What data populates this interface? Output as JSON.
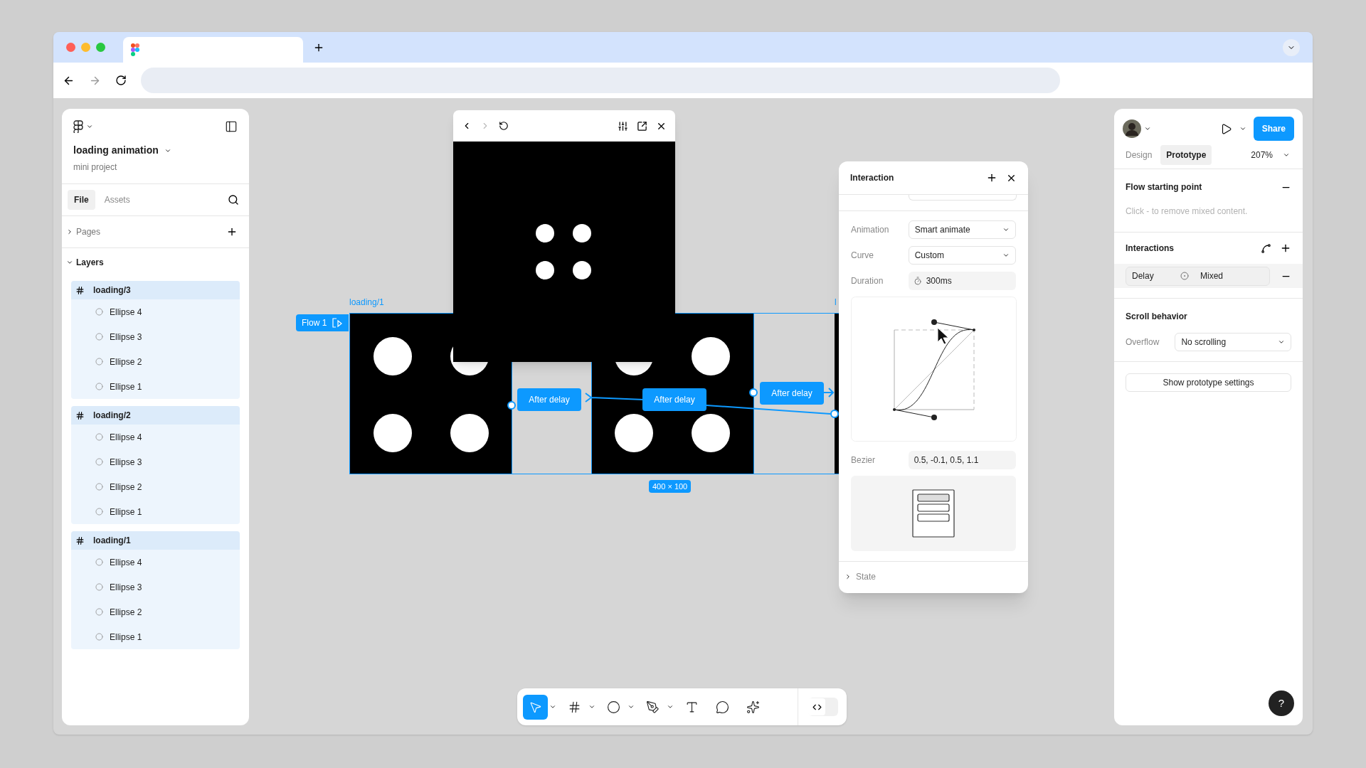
{
  "file": {
    "name": "loading animation",
    "project": "mini project"
  },
  "left_tabs": [
    {
      "label": "File",
      "selected": true
    },
    {
      "label": "Assets",
      "selected": false
    }
  ],
  "pages": {
    "label": "Pages",
    "expanded": false
  },
  "layers": {
    "label": "Layers",
    "expanded": true,
    "items": [
      {
        "name": "loading/3",
        "selected": true,
        "children": [
          {
            "name": "Ellipse 4"
          },
          {
            "name": "Ellipse 3"
          },
          {
            "name": "Ellipse 2"
          },
          {
            "name": "Ellipse 1"
          }
        ]
      },
      {
        "name": "loading/2",
        "selected": true,
        "children": [
          {
            "name": "Ellipse 4"
          },
          {
            "name": "Ellipse 3"
          },
          {
            "name": "Ellipse 2"
          },
          {
            "name": "Ellipse 1"
          }
        ]
      },
      {
        "name": "loading/1",
        "selected": true,
        "children": [
          {
            "name": "Ellipse 4"
          },
          {
            "name": "Ellipse 3"
          },
          {
            "name": "Ellipse 2"
          },
          {
            "name": "Ellipse 1"
          }
        ]
      }
    ]
  },
  "canvas": {
    "frame_labels": [
      "loading/1",
      "l"
    ],
    "flow_badge": "Flow 1",
    "connections": [
      "After delay",
      "After delay",
      "After delay"
    ],
    "size_badge": "400 × 100"
  },
  "interaction_panel": {
    "title": "Interaction",
    "rows": [
      {
        "kind": "dropdown",
        "label": "Animation",
        "value": "Smart animate"
      },
      {
        "kind": "dropdown",
        "label": "Curve",
        "value": "Custom"
      },
      {
        "kind": "duration",
        "label": "Duration",
        "value": "300ms"
      }
    ],
    "bezier": {
      "label": "Bezier",
      "value": "0.5, -0.1, 0.5, 1.1"
    },
    "state": {
      "label": "State",
      "expanded": false
    }
  },
  "right_panel": {
    "share": "Share",
    "tabs": [
      {
        "label": "Design",
        "selected": false
      },
      {
        "label": "Prototype",
        "selected": true
      }
    ],
    "zoom": "207%",
    "flow_start": {
      "title": "Flow starting point",
      "hint": "Click - to remove mixed content."
    },
    "interactions": {
      "title": "Interactions",
      "items": [
        {
          "trigger": "Delay",
          "action": "Mixed"
        }
      ]
    },
    "scroll": {
      "title": "Scroll behavior",
      "label": "Overflow",
      "value": "No scrolling"
    },
    "settings_button": "Show prototype settings",
    "help": "?"
  },
  "toolbar": {
    "tools": [
      {
        "kind": "move",
        "selected": true,
        "has_menu": true
      },
      {
        "kind": "frame",
        "selected": false,
        "has_menu": true
      },
      {
        "kind": "ellipse",
        "selected": false,
        "has_menu": true
      },
      {
        "kind": "pen",
        "selected": false,
        "has_menu": true
      },
      {
        "kind": "text",
        "selected": false,
        "has_menu": false
      },
      {
        "kind": "comment",
        "selected": false,
        "has_menu": false
      },
      {
        "kind": "ai",
        "selected": false,
        "has_menu": false
      }
    ],
    "dev_mode": {
      "on": false
    }
  }
}
